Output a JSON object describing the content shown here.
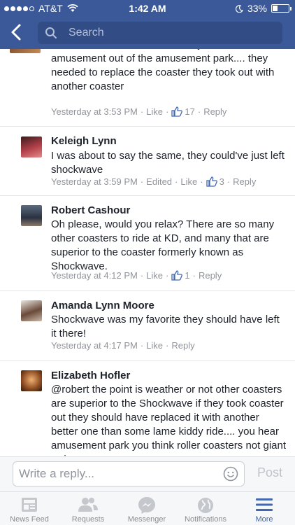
{
  "status_bar": {
    "carrier": "AT&T",
    "time": "1:42 AM",
    "battery": "33%",
    "battery_level": 0.33
  },
  "header": {
    "search_placeholder": "Search"
  },
  "comments": [
    {
      "name": "",
      "text": "for a ride as lame as this..... they have taken the amusement out of the amusement park.... they needed to replace the coaster they took out with another coaster",
      "time": "Yesterday at 3:53 PM",
      "edited": "",
      "like_label": "Like",
      "like_count": "17",
      "reply_label": "Reply"
    },
    {
      "name": "Keleigh Lynn",
      "text": "I was about to say the same, they could've just left shockwave",
      "time": "Yesterday at 3:59 PM",
      "edited": "Edited",
      "like_label": "Like",
      "like_count": "3",
      "reply_label": "Reply"
    },
    {
      "name": "Robert Cashour",
      "text": "Oh please, would you relax? There are so many other coasters to ride at KD, and many that are superior to the coaster formerly known as Shockwave.",
      "time": "Yesterday at 4:12 PM",
      "edited": "",
      "like_label": "Like",
      "like_count": "1",
      "reply_label": "Reply"
    },
    {
      "name": "Amanda Lynn Moore",
      "text": "Shockwave was my favorite they should have left it there!",
      "time": "Yesterday at 4:17 PM",
      "edited": "",
      "like_label": "Like",
      "like_count": "",
      "reply_label": "Reply"
    },
    {
      "name": "Elizabeth Hofler",
      "text": "@robert the point is weather or not other coasters are superior to the Shockwave if they took coaster out they should have replaced it with another better one than some lame kiddy ride.... you hear amusement park you think roller coasters not giant swing",
      "time": "",
      "edited": "",
      "like_label": "",
      "like_count": "",
      "reply_label": ""
    }
  ],
  "reply_bar": {
    "placeholder": "Write a reply...",
    "post_label": "Post"
  },
  "tabs": [
    {
      "label": "News Feed",
      "icon": "news-feed-icon",
      "active": false
    },
    {
      "label": "Requests",
      "icon": "friend-requests-icon",
      "active": false
    },
    {
      "label": "Messenger",
      "icon": "messenger-icon",
      "active": false
    },
    {
      "label": "Notifications",
      "icon": "globe-icon",
      "active": false
    },
    {
      "label": "More",
      "icon": "menu-icon",
      "active": true
    }
  ],
  "colors": {
    "brand": "#3b5998",
    "active_tab": "#4267b2",
    "meta_text": "#90949c"
  }
}
